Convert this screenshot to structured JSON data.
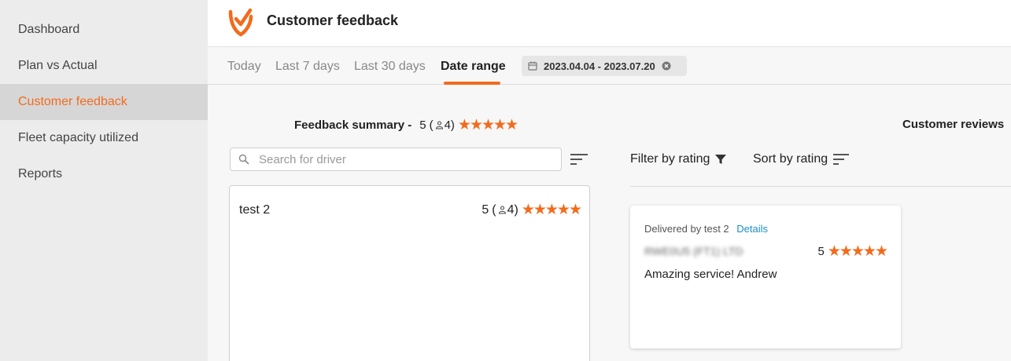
{
  "sidebar": {
    "items": [
      {
        "label": "Dashboard"
      },
      {
        "label": "Plan vs Actual"
      },
      {
        "label": "Customer feedback"
      },
      {
        "label": "Fleet capacity utilized"
      },
      {
        "label": "Reports"
      }
    ],
    "active_index": 2
  },
  "header": {
    "title": "Customer feedback",
    "logo_icon": "checkmark-shield-logo"
  },
  "tabs": [
    {
      "label": "Today"
    },
    {
      "label": "Last 7 days"
    },
    {
      "label": "Last 30 days"
    },
    {
      "label": "Date range"
    }
  ],
  "active_tab": "Date range",
  "date_range": {
    "value": "2023.04.04 - 2023.07.20",
    "icon": "calendar-icon",
    "clear_icon": "close-circle-icon"
  },
  "summary": {
    "label": "Feedback summary -",
    "rating": "5",
    "open_paren": "(",
    "count": "4",
    "close_paren": ")",
    "stars": "★★★★★"
  },
  "reviews": {
    "title": "Customer reviews",
    "filter_label": "Filter by rating",
    "sort_label": "Sort by rating"
  },
  "search": {
    "placeholder": "Search for driver"
  },
  "drivers": [
    {
      "name": "test 2",
      "rating": "5",
      "open_paren": "(",
      "count": "4",
      "close_paren": ")",
      "stars": "★★★★★"
    }
  ],
  "review_card": {
    "delivered_by": "Delivered by test 2",
    "details_label": "Details",
    "customer_blurred": "RWE0U5 (FT1) LTD",
    "rating": "5",
    "stars": "★★★★★",
    "comment": "Amazing service! Andrew"
  },
  "colors": {
    "accent": "#f26b1d",
    "link": "#1a8fc7",
    "sidebar_bg": "#ececec",
    "sidebar_active_bg": "#d6d6d6"
  }
}
